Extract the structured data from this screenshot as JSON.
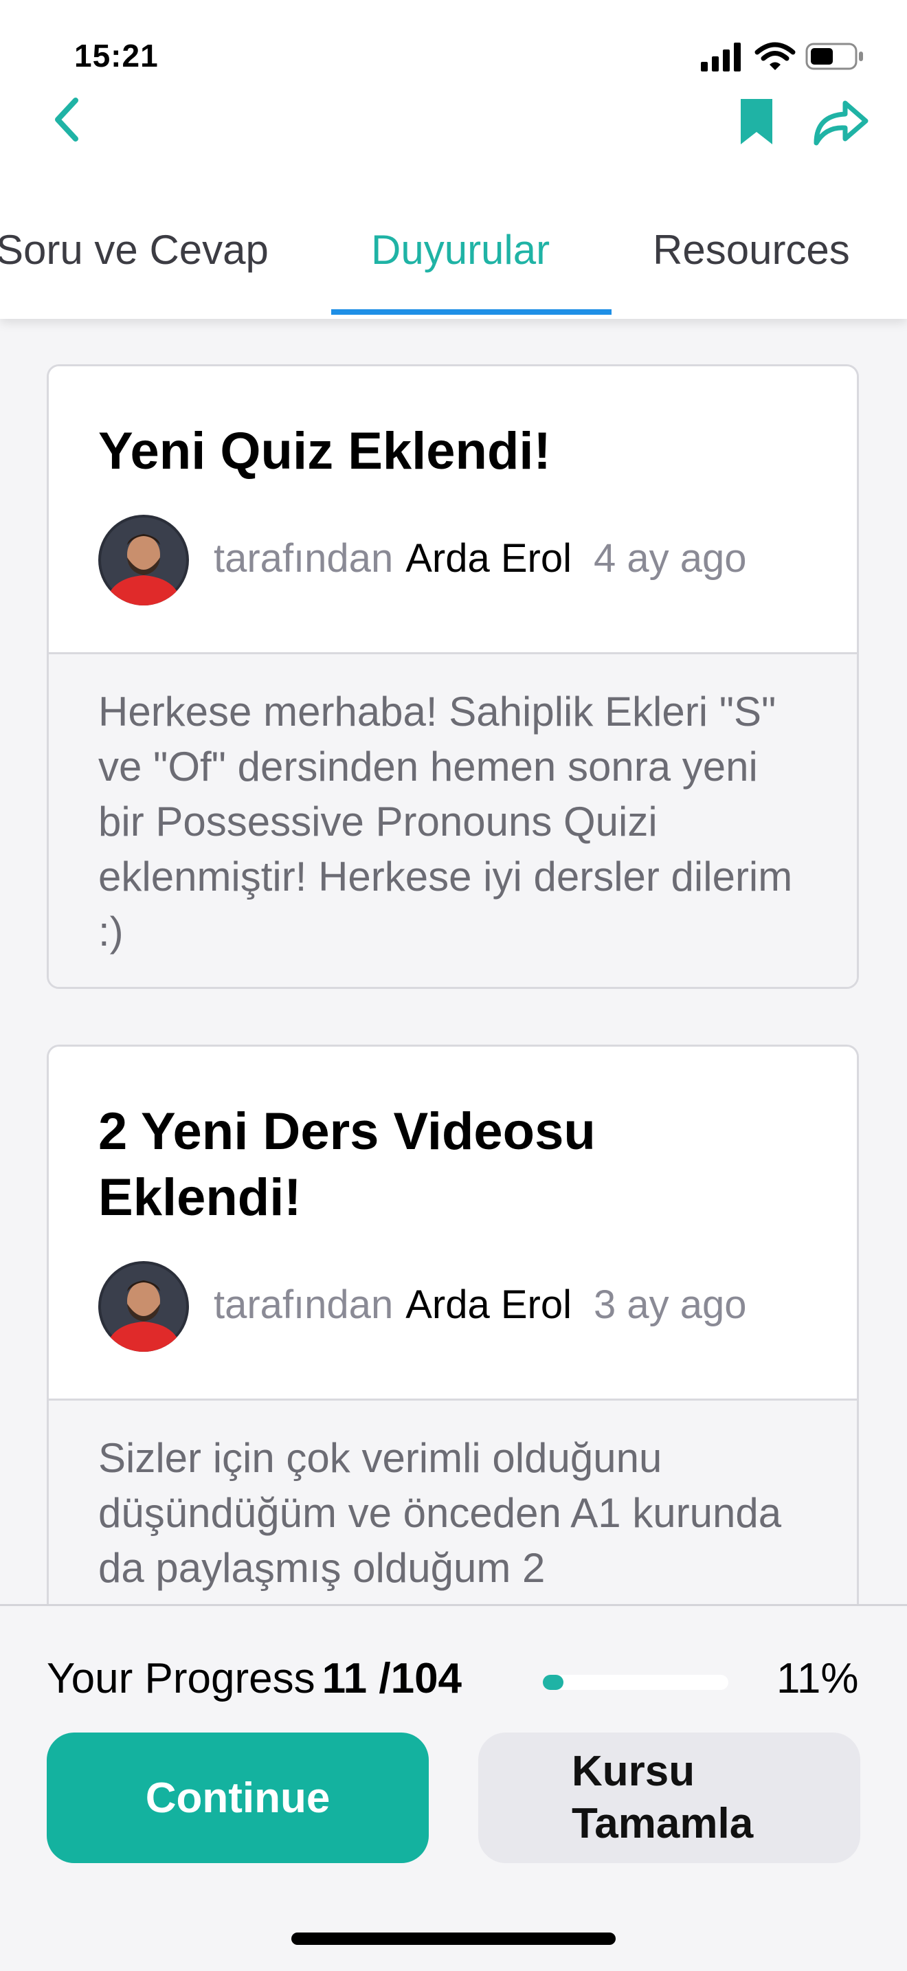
{
  "status_bar": {
    "time": "15:21",
    "icons": [
      "signal-icon",
      "wifi-icon",
      "battery-icon"
    ]
  },
  "nav": {
    "icons": [
      "chevron-left-icon",
      "bookmark-icon",
      "share-icon"
    ]
  },
  "tabs": [
    {
      "label": "Soru ve Cevap",
      "active": false
    },
    {
      "label": "Duyurular",
      "active": true
    },
    {
      "label": "Resources",
      "active": false
    }
  ],
  "announcements": [
    {
      "title": "Yeni Quiz Eklendi!",
      "by_label": "tarafından",
      "author": "Arda Erol",
      "ago": "4 ay ago",
      "body": "Herkese merhaba! Sahiplik Ekleri \"S\" ve \"Of\" dersinden hemen sonra yeni bir Possessive Pronouns Quizi eklenmiştir! Herkese iyi dersler dilerim :)"
    },
    {
      "title": "2 Yeni Ders Videosu Eklendi!",
      "by_label": "tarafından",
      "author": "Arda Erol",
      "ago": "3 ay ago",
      "body": "Sizler için çok verimli olduğunu düşündüğüm ve önceden A1 kurunda da paylaşmış olduğum 2"
    }
  ],
  "progress": {
    "label": "Your Progress",
    "count": "11 /104",
    "percent_text": "11%",
    "fraction": 0.11
  },
  "buttons": {
    "continue": "Continue",
    "complete": "Kursu Tamamla"
  },
  "colors": {
    "accent": "#1fb3a5",
    "tab_underline": "#1e8fe6",
    "button_primary": "#14b29f"
  }
}
